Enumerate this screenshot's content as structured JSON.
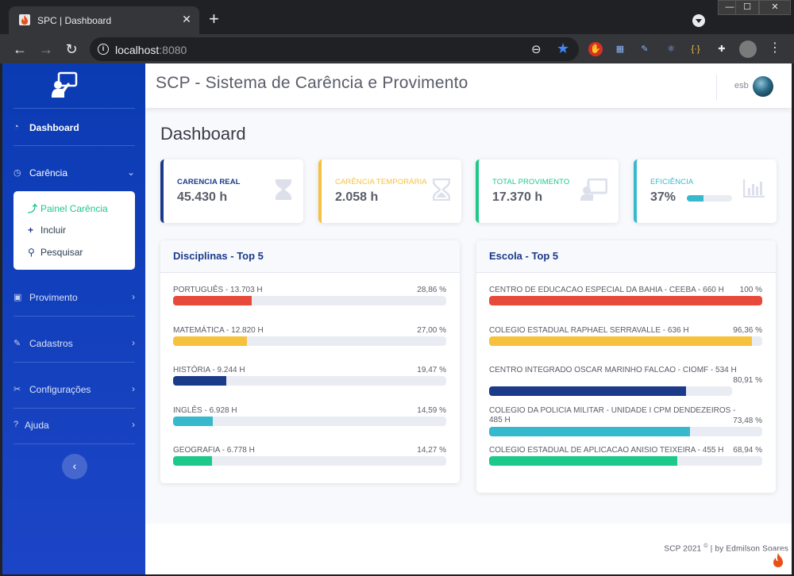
{
  "browser": {
    "tab_title": "SPC | Dashboard",
    "tab_close": "✕",
    "new_tab": "+",
    "url_host": "localhost",
    "url_port": ":8080"
  },
  "app": {
    "title": "SCP - Sistema de Carência e Provimento",
    "user": "esb",
    "page_title": "Dashboard"
  },
  "sidebar": {
    "dashboard": "Dashboard",
    "carencia": "Carência",
    "sub": {
      "painel": "Painel Carência",
      "incluir": "Incluir",
      "pesquisar": "Pesquisar"
    },
    "provimento": "Provimento",
    "cadastros": "Cadastros",
    "configuracoes": "Configurações",
    "ajuda": "Ajuda",
    "toggle": "‹"
  },
  "kpis": [
    {
      "label": "CARENCIA REAL",
      "value": "45.430 h",
      "color": "#1b3a8a"
    },
    {
      "label": "CARÊNCIA TEMPORÁRIA",
      "value": "2.058 h",
      "color": "#f6c23e"
    },
    {
      "label": "TOTAL PROVIMENTO",
      "value": "17.370 h",
      "color": "#1cc88a"
    },
    {
      "label": "EFICIÊNCIA",
      "value": "37%",
      "color": "#36b9cc",
      "progress": 0.37
    }
  ],
  "disciplinas": {
    "title": "Disciplinas - Top 5",
    "rows": [
      {
        "label": "PORTUGUÊS - 13.703 h",
        "pct": "28,86 %",
        "value": 28.86,
        "color": "#e74a3b"
      },
      {
        "label": "MATEMÁTICA - 12.820 h",
        "pct": "27,00 %",
        "value": 27.0,
        "color": "#f6c23e"
      },
      {
        "label": "HISTÓRIA - 9.244 h",
        "pct": "19,47 %",
        "value": 19.47,
        "color": "#1b3a8a"
      },
      {
        "label": "INGLÊS - 6.928 h",
        "pct": "14,59 %",
        "value": 14.59,
        "color": "#36b9cc"
      },
      {
        "label": "GEOGRAFIA - 6.778 h",
        "pct": "14,27 %",
        "value": 14.27,
        "color": "#1cc88a"
      }
    ]
  },
  "escolas": {
    "title": "Escola - Top 5",
    "rows": [
      {
        "label": "CENTRO DE EDUCACAO ESPECIAL DA BAHIA - CEEBA - 660 h",
        "pct": "100 %",
        "value": 100,
        "color": "#e74a3b"
      },
      {
        "label": "COLEGIO ESTADUAL RAPHAEL SERRAVALLE - 636 h",
        "pct": "96,36 %",
        "value": 96.36,
        "color": "#f6c23e"
      },
      {
        "label": "CENTRO INTEGRADO OSCAR MARINHO FALCAO - CIOMF - 534 h",
        "pct": "80,91 %",
        "value": 80.91,
        "color": "#1b3a8a"
      },
      {
        "label": "COLEGIO DA POLICIA MILITAR - UNIDADE I CPM DENDEZEIROS - 485 h",
        "pct": "73,48 %",
        "value": 73.48,
        "color": "#36b9cc"
      },
      {
        "label": "COLEGIO ESTADUAL DE APLICACAO ANISIO TEIXEIRA - 455 h",
        "pct": "68,94 %",
        "value": 68.94,
        "color": "#1cc88a"
      }
    ]
  },
  "footer": {
    "text_a": "SCP 2021",
    "copy": "©",
    "text_b": " | by Edmilson Soares"
  }
}
